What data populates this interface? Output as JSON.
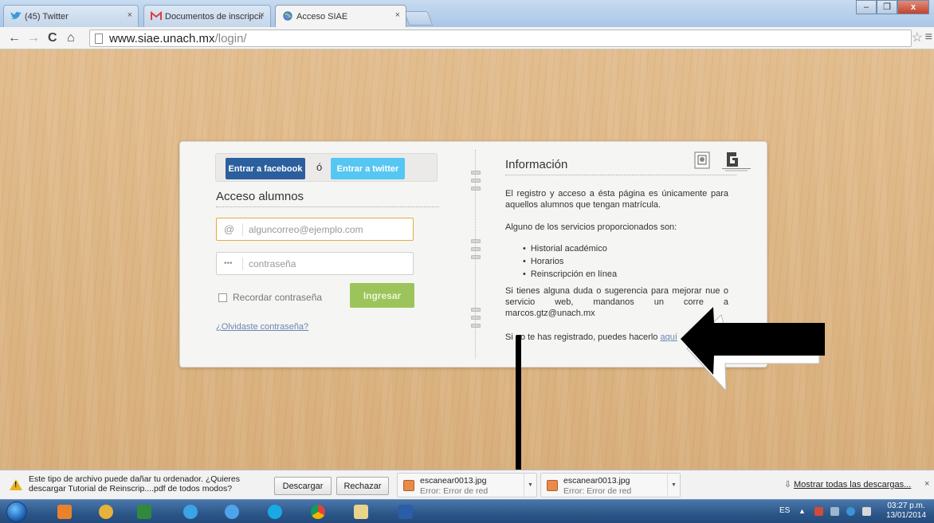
{
  "tabs": [
    {
      "label": "(45) Twitter",
      "close": "×"
    },
    {
      "label": "Documentos de inscripció",
      "close": "×"
    },
    {
      "label": "Acceso SIAE",
      "close": "×"
    }
  ],
  "window_controls": {
    "minimize": "–",
    "maximize": "❐",
    "close": "x"
  },
  "toolbar": {
    "back": "←",
    "forward": "→",
    "reload": "C",
    "home": "⌂",
    "url_host": "www.siae.unach.mx",
    "url_path": "/login/",
    "star": "☆",
    "menu": "≡"
  },
  "login": {
    "facebook_label": "Entrar a facebook",
    "or_label": "ó",
    "twitter_label": "Entrar a twitter",
    "section_title": "Acceso alumnos",
    "email_icon": "@",
    "email_placeholder": "alguncorreo@ejemplo.com",
    "password_icon": "•••",
    "password_placeholder": "contraseña",
    "remember_label": "Recordar contraseña",
    "submit_label": "Ingresar",
    "forgot_label": "¿Olvidaste contraseña?"
  },
  "info": {
    "title": "Información",
    "para1": "El registro y acceso a ésta página es únicamente para aquellos alumnos que tengan matrícula.",
    "para2": "Alguno de los servicios proporcionados son:",
    "services": [
      "Historial académico",
      "Horarios",
      "Reinscripción en línea"
    ],
    "para3": "Si tienes alguna duda o sugerencia para mejorar nue   o servicio web, mandanos un corre   a marcos.gtz@unach.mx",
    "para4_text": "Si no te has registrado, puedes hacerlo ",
    "para4_link": "aquí"
  },
  "download_bar": {
    "warning_line1": "Este tipo de archivo puede dañar tu ordenador. ¿Quieres",
    "warning_line2": "descargar Tutorial de Reinscrip....pdf de todos modos?",
    "keep_label": "Descargar",
    "discard_label": "Rechazar",
    "items": [
      {
        "name": "escanear0013.jpg",
        "status": "Error: Error de red"
      },
      {
        "name": "escanear0013.jpg",
        "status": "Error: Error de red"
      }
    ],
    "show_all_label": "Mostrar todas las descargas...",
    "close": "×"
  },
  "taskbar": {
    "language": "ES",
    "time": "03:27 p.m.",
    "date": "13/01/2014"
  },
  "colors": {
    "facebook": "#2b5f9e",
    "twitter": "#55c7f2",
    "login_button": "#9dc45a",
    "email_focus_border": "#e3ac3e",
    "page_wood": "#dcb584"
  }
}
